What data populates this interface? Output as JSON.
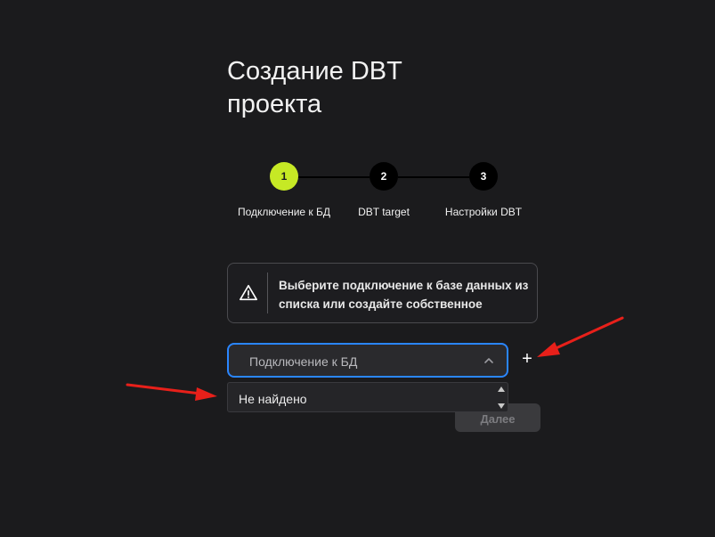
{
  "page": {
    "title_line1": "Создание DBT",
    "title_line2": "проекта"
  },
  "stepper": {
    "steps": [
      {
        "number": "1",
        "label": "Подключение к БД",
        "active": true
      },
      {
        "number": "2",
        "label": "DBT target",
        "active": false
      },
      {
        "number": "3",
        "label": "Настройки DBT",
        "active": false
      }
    ],
    "current_step": 1
  },
  "alert": {
    "icon": "warning-triangle-icon",
    "text": "Выберите подключение к базе данных из списка или создайте собственное"
  },
  "connection_select": {
    "placeholder": "Подключение к БД",
    "expanded": true,
    "chevron_icon": "chevron-up-icon",
    "options": [
      "Не найдено"
    ]
  },
  "add_button": {
    "icon": "plus-icon",
    "symbol": "+"
  },
  "next_button": {
    "label": "Далее",
    "disabled": true
  },
  "colors": {
    "background": "#1b1b1d",
    "accent_active_step": "#c6e925",
    "focus_border": "#2a86ff",
    "annotation_arrow": "#e8201a"
  }
}
